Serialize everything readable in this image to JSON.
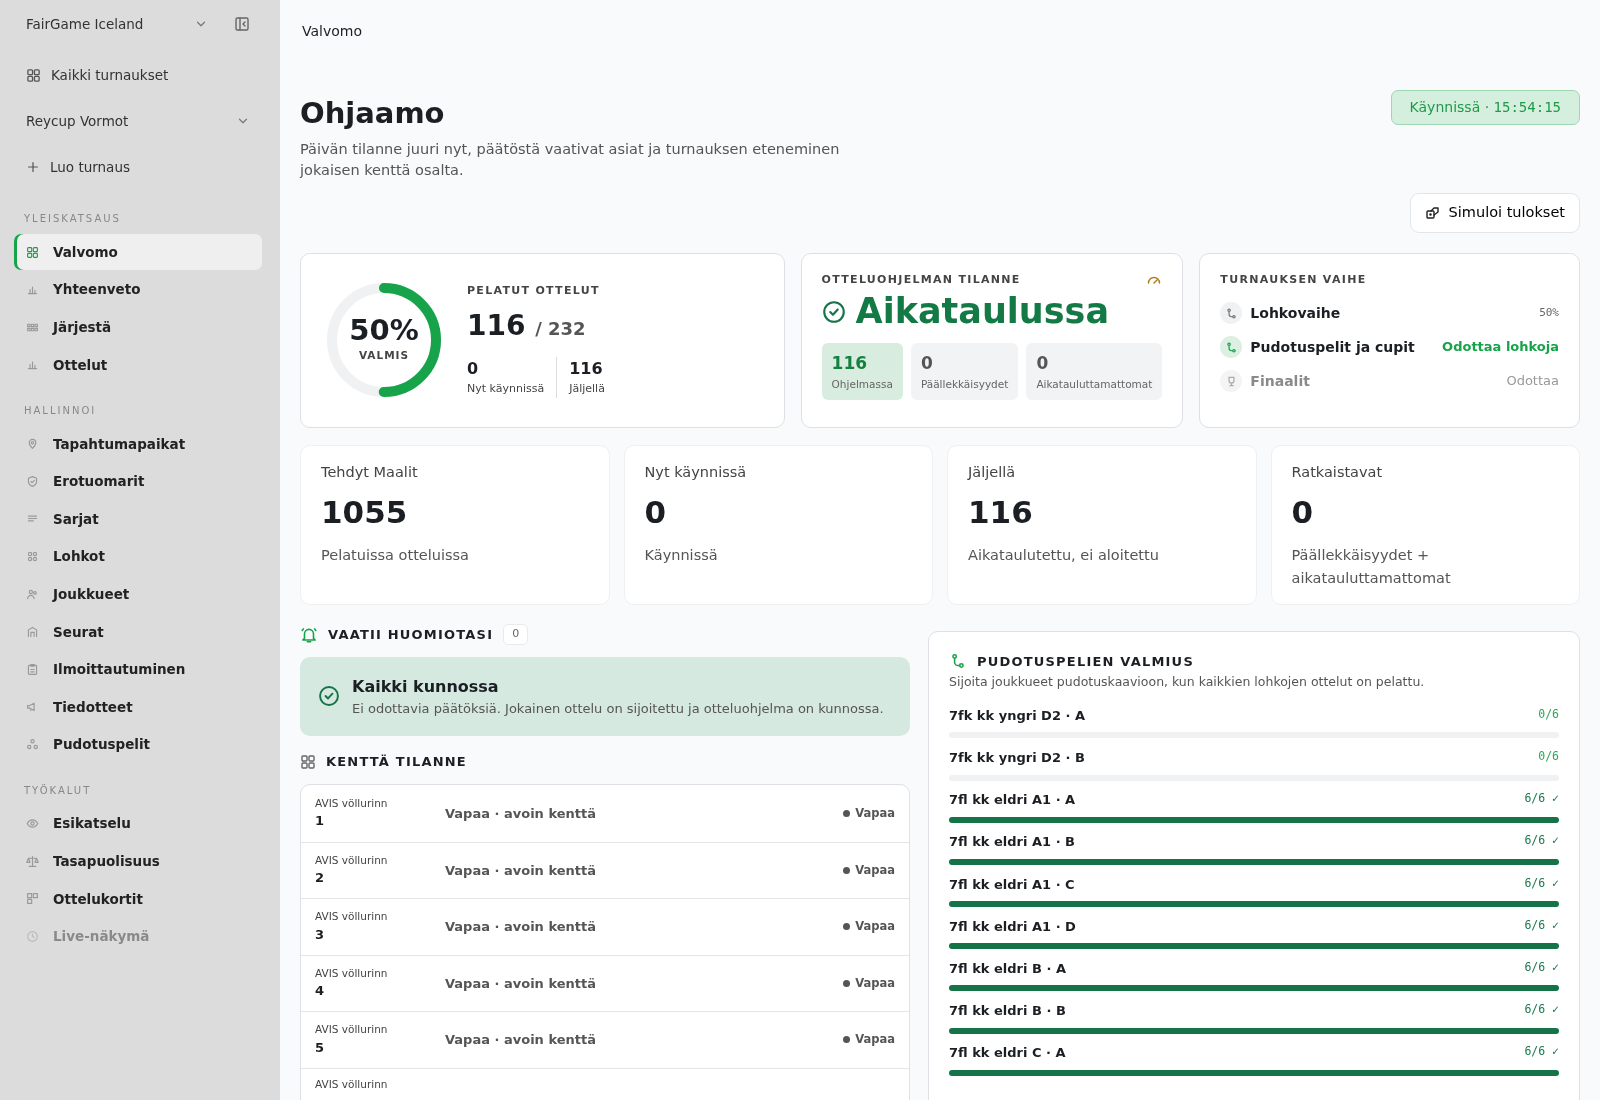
{
  "sidebar": {
    "org": "FairGame Iceland",
    "all_link": "Kaikki turnaukset",
    "tournament": "Reycup Vormot",
    "create": "Luo turnaus",
    "sections": [
      {
        "label": "YLEISKATSAUS",
        "items": [
          {
            "label": "Valvomo",
            "selected": true,
            "disabled": false
          },
          {
            "label": "Yhteenveto",
            "selected": false,
            "disabled": false
          },
          {
            "label": "Järjestä",
            "selected": false,
            "disabled": false
          },
          {
            "label": "Ottelut",
            "selected": false,
            "disabled": false
          }
        ]
      },
      {
        "label": "HALLINNOI",
        "items": [
          {
            "label": "Tapahtumapaikat",
            "selected": false,
            "disabled": false
          },
          {
            "label": "Erotuomarit",
            "selected": false,
            "disabled": false
          },
          {
            "label": "Sarjat",
            "selected": false,
            "disabled": false
          },
          {
            "label": "Lohkot",
            "selected": false,
            "disabled": false
          },
          {
            "label": "Joukkueet",
            "selected": false,
            "disabled": false
          },
          {
            "label": "Seurat",
            "selected": false,
            "disabled": false
          },
          {
            "label": "Ilmoittautuminen",
            "selected": false,
            "disabled": false
          },
          {
            "label": "Tiedotteet",
            "selected": false,
            "disabled": false
          },
          {
            "label": "Pudotuspelit",
            "selected": false,
            "disabled": false
          }
        ]
      },
      {
        "label": "TYÖKALUT",
        "items": [
          {
            "label": "Esikatselu",
            "selected": false,
            "disabled": false
          },
          {
            "label": "Tasapuolisuus",
            "selected": false,
            "disabled": false
          },
          {
            "label": "Ottelukortit",
            "selected": false,
            "disabled": false
          },
          {
            "label": "Live-näkymä",
            "selected": false,
            "disabled": true
          }
        ]
      }
    ]
  },
  "breadcrumb": "Valvomo",
  "title": "Ohjaamo",
  "subtitle": "Päivän tilanne juuri nyt, päätöstä vaativat asiat ja turnauksen eteneminen jokaisen kenttä osalta.",
  "live_badge": {
    "label": "Käynnissä ·",
    "time": "15:54:15"
  },
  "simulate_button": "Simuloi tulokset",
  "played": {
    "heading": "PELATUT OTTELUT",
    "level": 0.5,
    "percent": "50%",
    "percent_label": "VALMIS",
    "count": "116",
    "total": "/ 232",
    "stats": [
      {
        "value": "0",
        "label": "Nyt käynnissä"
      },
      {
        "value": "116",
        "label": "Jäljellä"
      }
    ]
  },
  "schedule": {
    "heading": "OTTELUOHJELMAN TILANNE",
    "status": "Aikataulussa",
    "tiles": [
      {
        "value": "116",
        "label": "Ohjelmassa",
        "highlighted": true
      },
      {
        "value": "0",
        "label": "Päällekkäisyydet",
        "highlighted": false
      },
      {
        "value": "0",
        "label": "Aikatauluttamattomat",
        "highlighted": false
      }
    ]
  },
  "phase": {
    "heading": "TURNAUKSEN VAIHE",
    "items": [
      {
        "label": "Lohkovaihe",
        "status": "50%",
        "kind": "active"
      },
      {
        "label": "Pudotuspelit ja cupit",
        "status": "Odottaa lohkoja",
        "kind": "next"
      },
      {
        "label": "Finaalit",
        "status": "Odottaa",
        "kind": "pending"
      }
    ]
  },
  "stat_cards": [
    {
      "title": "Tehdyt Maalit",
      "value": "1055",
      "caption": "Pelatuissa otteluissa"
    },
    {
      "title": "Nyt käynnissä",
      "value": "0",
      "caption": "Käynnissä"
    },
    {
      "title": "Jäljellä",
      "value": "116",
      "caption": "Aikataulutettu, ei aloitettu"
    },
    {
      "title": "Ratkaistavat",
      "value": "0",
      "caption": "Päällekkäisyydet + aikatauluttamattomat"
    }
  ],
  "attention": {
    "heading": "VAATII HUOMIOTASI",
    "count": "0",
    "alert_title": "Kaikki kunnossa",
    "alert_text": "Ei odottavia päätöksiä. Jokainen ottelu on sijoitettu ja otteluohjelma on kunnossa."
  },
  "fields": {
    "heading": "KENTTÄ TILANNE",
    "rows": [
      {
        "venue": "AVIS völlurinn",
        "number": "1",
        "activity": "Vapaa · avoin kenttä",
        "status": "Vapaa"
      },
      {
        "venue": "AVIS völlurinn",
        "number": "2",
        "activity": "Vapaa · avoin kenttä",
        "status": "Vapaa"
      },
      {
        "venue": "AVIS völlurinn",
        "number": "3",
        "activity": "Vapaa · avoin kenttä",
        "status": "Vapaa"
      },
      {
        "venue": "AVIS völlurinn",
        "number": "4",
        "activity": "Vapaa · avoin kenttä",
        "status": "Vapaa"
      },
      {
        "venue": "AVIS völlurinn",
        "number": "5",
        "activity": "Vapaa · avoin kenttä",
        "status": "Vapaa"
      },
      {
        "venue": "AVIS völlurinn"
      }
    ]
  },
  "playoffs": {
    "heading": "PUDOTUSPELIEN VALMIUS",
    "description": "Sijoita joukkueet pudotuskaavioon, kun kaikkien lohkojen ottelut on pelattu.",
    "groups": [
      {
        "name": "7fk kk yngri D2 · A",
        "reading": "0/6",
        "level": 0
      },
      {
        "name": "7fk kk yngri D2 · B",
        "reading": "0/6",
        "level": 0
      },
      {
        "name": "7fl kk eldri A1 · A",
        "reading": "6/6 ✓",
        "level": 1
      },
      {
        "name": "7fl kk eldri A1 · B",
        "reading": "6/6 ✓",
        "level": 1
      },
      {
        "name": "7fl kk eldri A1 · C",
        "reading": "6/6 ✓",
        "level": 1
      },
      {
        "name": "7fl kk eldri A1 · D",
        "reading": "6/6 ✓",
        "level": 1
      },
      {
        "name": "7fl kk eldri B · A",
        "reading": "6/6 ✓",
        "level": 1
      },
      {
        "name": "7fl kk eldri B · B",
        "reading": "6/6 ✓",
        "level": 1
      },
      {
        "name": "7fl kk eldri C · A",
        "reading": "6/6 ✓",
        "level": 1
      }
    ]
  }
}
